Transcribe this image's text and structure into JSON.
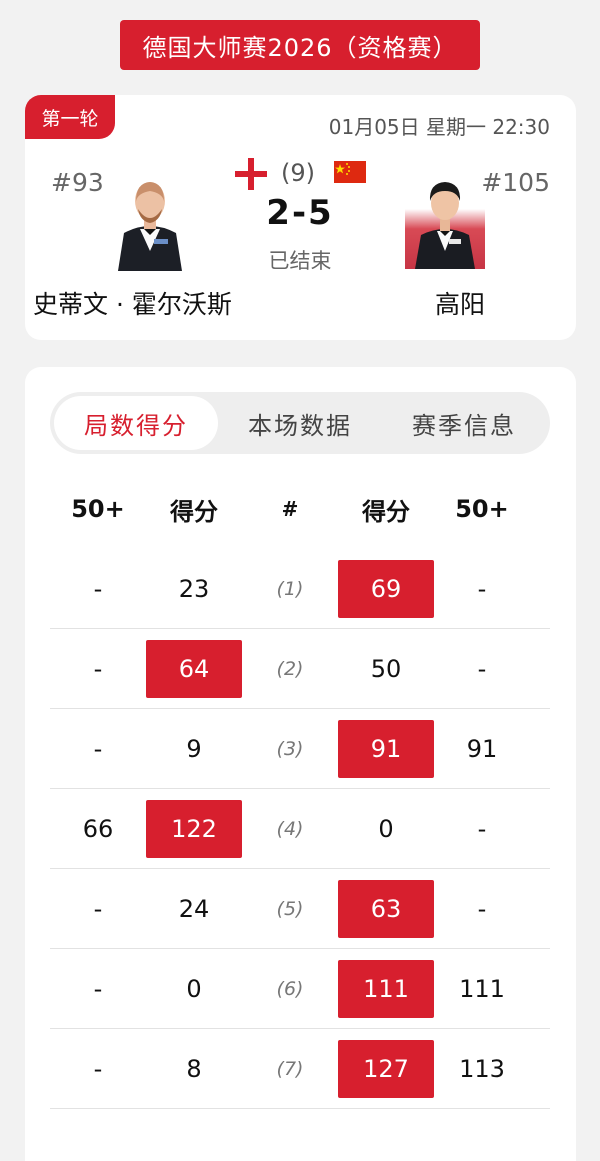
{
  "header": {
    "title": "德国大师赛2026（资格赛）"
  },
  "match": {
    "round": "第一轮",
    "datetime": "01月05日 星期一 22:30",
    "seed": "(9)",
    "score": "2-5",
    "status": "已结束",
    "player_left": {
      "rank": "#93",
      "name": "史蒂文 · 霍尔沃斯",
      "flag": "england-flag-icon"
    },
    "player_right": {
      "rank": "#105",
      "name": "高阳",
      "flag": "china-flag-icon"
    }
  },
  "tabs": [
    {
      "label": "局数得分",
      "active": true
    },
    {
      "label": "本场数据",
      "active": false
    },
    {
      "label": "赛季信息",
      "active": false
    }
  ],
  "table": {
    "headers": [
      "50+",
      "得分",
      "#",
      "得分",
      "50+"
    ],
    "rows": [
      {
        "left_50": "-",
        "left_score": "23",
        "frame": "(1)",
        "right_score": "69",
        "right_50": "-",
        "winner": "right"
      },
      {
        "left_50": "-",
        "left_score": "64",
        "frame": "(2)",
        "right_score": "50",
        "right_50": "-",
        "winner": "left"
      },
      {
        "left_50": "-",
        "left_score": "9",
        "frame": "(3)",
        "right_score": "91",
        "right_50": "91",
        "winner": "right"
      },
      {
        "left_50": "66",
        "left_score": "122",
        "frame": "(4)",
        "right_score": "0",
        "right_50": "-",
        "winner": "left"
      },
      {
        "left_50": "-",
        "left_score": "24",
        "frame": "(5)",
        "right_score": "63",
        "right_50": "-",
        "winner": "right"
      },
      {
        "left_50": "-",
        "left_score": "0",
        "frame": "(6)",
        "right_score": "111",
        "right_50": "111",
        "winner": "right"
      },
      {
        "left_50": "-",
        "left_score": "8",
        "frame": "(7)",
        "right_score": "127",
        "right_50": "113",
        "winner": "right"
      }
    ]
  },
  "colors": {
    "accent": "#d71f2e",
    "background": "#f2f2f2"
  }
}
